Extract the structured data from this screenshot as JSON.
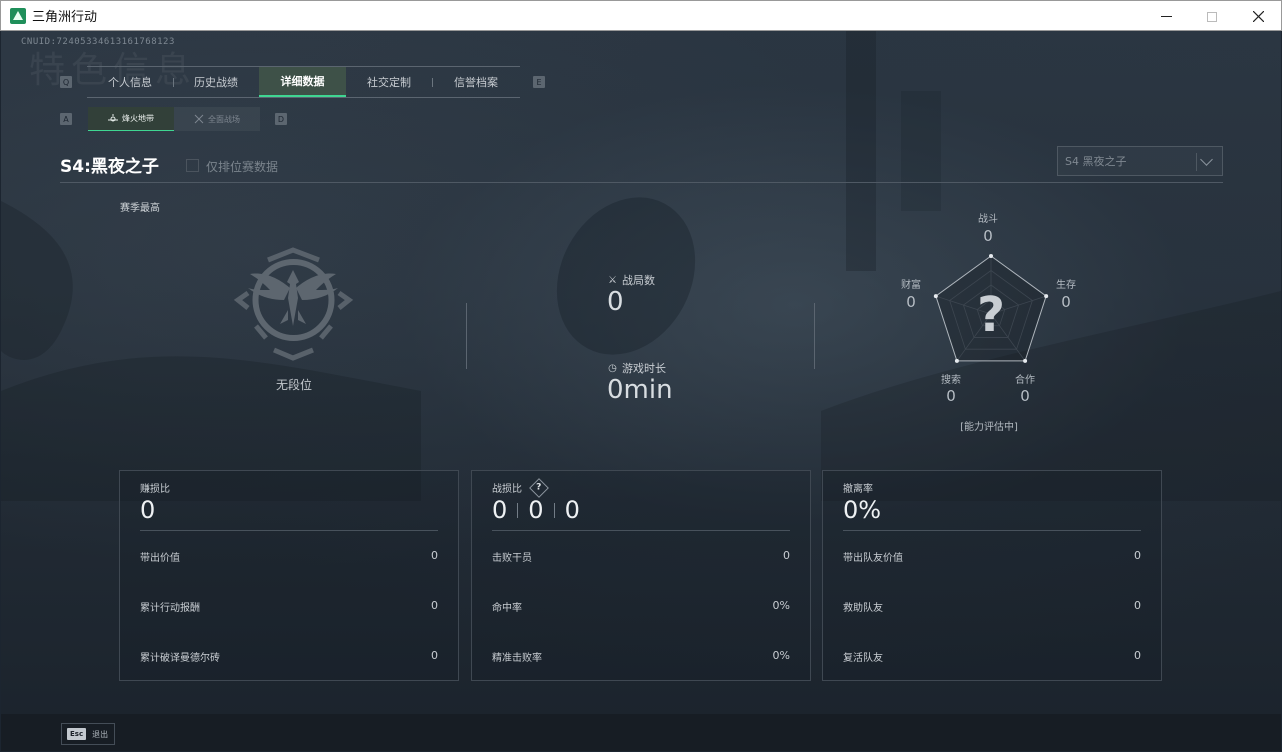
{
  "window": {
    "title": "三角洲行动",
    "min_icon": "minimize-icon",
    "max_icon": "maximize-icon",
    "close_icon": "close-icon"
  },
  "header": {
    "uid": "CNUID:7240533461316176812З",
    "watermark": "特色信息"
  },
  "main_tabs": {
    "left_key": "Q",
    "right_key": "E",
    "items": [
      {
        "label": "个人信息"
      },
      {
        "label": "历史战绩"
      },
      {
        "label": "详细数据",
        "active": true
      },
      {
        "label": "社交定制"
      },
      {
        "label": "信誉档案"
      }
    ]
  },
  "sub_tabs": {
    "left_key": "A",
    "right_key": "D",
    "items": [
      {
        "label": "烽火地带",
        "icon": "beacon-icon",
        "active": true
      },
      {
        "label": "全面战场",
        "icon": "battlefield-icon"
      }
    ]
  },
  "season": {
    "title": "S4:黑夜之子",
    "ranked_only_label": "仅排位赛数据",
    "ranked_only_checked": false,
    "select_value": "S4 黑夜之子"
  },
  "rank": {
    "section_label": "赛季最高",
    "rank_name": "无段位",
    "emblem_icon": "eagle-rank-emblem-icon"
  },
  "mid_stats": {
    "matches_label": "战局数",
    "matches_value": "0",
    "playtime_label": "游戏时长",
    "playtime_value": "0min"
  },
  "radar": {
    "axes": [
      {
        "label": "战斗",
        "value": "0",
        "score": 0
      },
      {
        "label": "生存",
        "value": "0",
        "score": 0
      },
      {
        "label": "合作",
        "value": "0",
        "score": 0
      },
      {
        "label": "搜索",
        "value": "0",
        "score": 0
      },
      {
        "label": "财富",
        "value": "0",
        "score": 0
      }
    ],
    "center_glyph": "?",
    "status": "[能力评估中]"
  },
  "cards": {
    "profit": {
      "head_label": "赚损比",
      "head_value": "0",
      "rows": [
        {
          "label": "带出价值",
          "value": "0"
        },
        {
          "label": "累计行动报酬",
          "value": "0"
        },
        {
          "label": "累计破译曼德尔砖",
          "value": "0"
        }
      ]
    },
    "combat": {
      "head_label": "战损比",
      "kd": [
        "0",
        "0",
        "0"
      ],
      "rows": [
        {
          "label": "击败干员",
          "value": "0"
        },
        {
          "label": "命中率",
          "value": "0%"
        },
        {
          "label": "精准击败率",
          "value": "0%"
        }
      ]
    },
    "extract": {
      "head_label": "撤离率",
      "head_value": "0%",
      "rows": [
        {
          "label": "带出队友价值",
          "value": "0"
        },
        {
          "label": "救助队友",
          "value": "0"
        },
        {
          "label": "复活队友",
          "value": "0"
        }
      ]
    }
  },
  "footer": {
    "esc_key": "Esc",
    "esc_label": "退出"
  },
  "colors": {
    "accent": "#3fd692",
    "bg": "#1c2530"
  }
}
